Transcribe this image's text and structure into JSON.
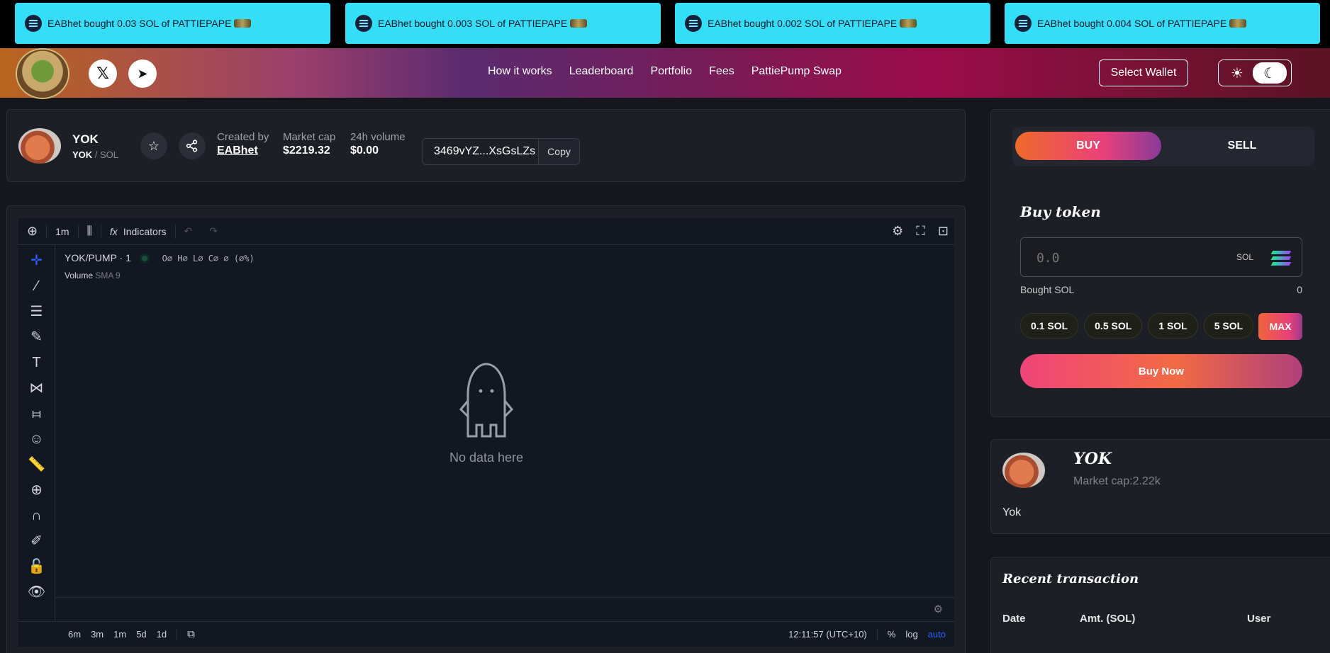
{
  "ticker": [
    {
      "text": "EABhet bought 0.03 SOL of PATTIEPAPE"
    },
    {
      "text": "EABhet bought 0.003 SOL of PATTIEPAPE"
    },
    {
      "text": "EABhet bought 0.002 SOL of PATTIEPAPE"
    },
    {
      "text": "EABhet bought 0.004 SOL of PATTIEPAPE"
    }
  ],
  "header": {
    "social_x": "𝕏",
    "social_telegram": "➤",
    "nav": [
      "How it works",
      "Leaderboard",
      "Portfolio",
      "Fees",
      "PattiePump Swap"
    ],
    "wallet_label": "Select Wallet",
    "theme_sun": "☀",
    "theme_moon": "☾"
  },
  "token": {
    "name": "YOK",
    "symbol": "YOK",
    "quote": " / SOL",
    "created_by_label": "Created by",
    "created_by": "EABhet",
    "market_cap_label": "Market cap",
    "market_cap": "$2219.32",
    "volume_label": "24h volume",
    "volume": "$0.00",
    "address": "3469vYZ...XsGsLZs",
    "copy_label": "Copy"
  },
  "chart": {
    "interval": "1m",
    "indicators_label": "Indicators",
    "symbol": "YOK/PUMP · 1",
    "ohlc": "O∅ H∅ L∅ C∅ ∅ (∅%)",
    "volume_label": "Volume",
    "volume_ind": "SMA 9",
    "no_data": "No data here",
    "ranges": [
      "6m",
      "3m",
      "1m",
      "5d",
      "1d"
    ],
    "time": "12:11:57 (UTC+10)",
    "pct": "%",
    "log": "log",
    "auto": "auto"
  },
  "trade": {
    "buy_tab": "BUY",
    "sell_tab": "SELL",
    "title": "Buy token",
    "amount_placeholder": "0.0",
    "unit": "SOL",
    "bought_label": "Bought SOL",
    "bought_value": "0",
    "presets": [
      "0.1 SOL",
      "0.5 SOL",
      "1 SOL",
      "5 SOL"
    ],
    "max_label": "MAX",
    "buy_now_label": "Buy Now"
  },
  "info": {
    "name": "YOK",
    "market_cap": "Market cap:2.22k",
    "description": "Yok"
  },
  "recent": {
    "title": "Recent transaction",
    "columns": [
      "Date",
      "Amt. (SOL)",
      "User"
    ]
  }
}
